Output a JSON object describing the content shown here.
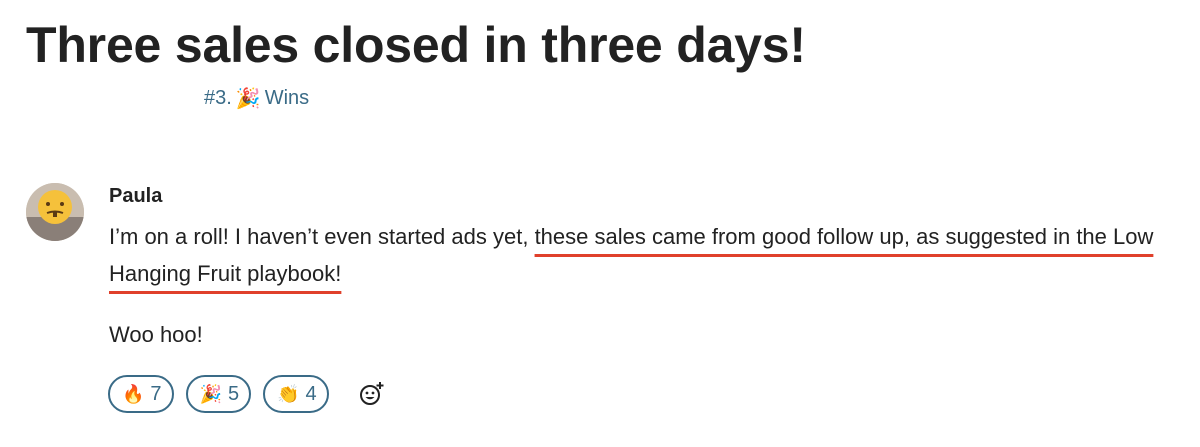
{
  "topic": {
    "title": "Three sales closed in three days!",
    "category": {
      "number": "#3.",
      "emoji": "🎉",
      "name": "Wins"
    }
  },
  "post": {
    "author": "Paula",
    "text_before": "I’m on a roll! I haven’t even started ads yet, ",
    "text_highlight": "these sales came from good follow up, as suggested in the Low Hanging Fruit playbook!",
    "text_after": "Woo hoo!",
    "highlight_color": "#e0402b"
  },
  "reactions": [
    {
      "emoji": "🔥",
      "name": "fire-icon",
      "count": "7"
    },
    {
      "emoji": "🎉",
      "name": "party-popper-icon",
      "count": "5"
    },
    {
      "emoji": "👏",
      "name": "clapping-hands-icon",
      "count": "4"
    }
  ],
  "add_reaction_icon": "smiley-plus-icon",
  "colors": {
    "accent": "#3a6b87",
    "text": "#222222"
  }
}
